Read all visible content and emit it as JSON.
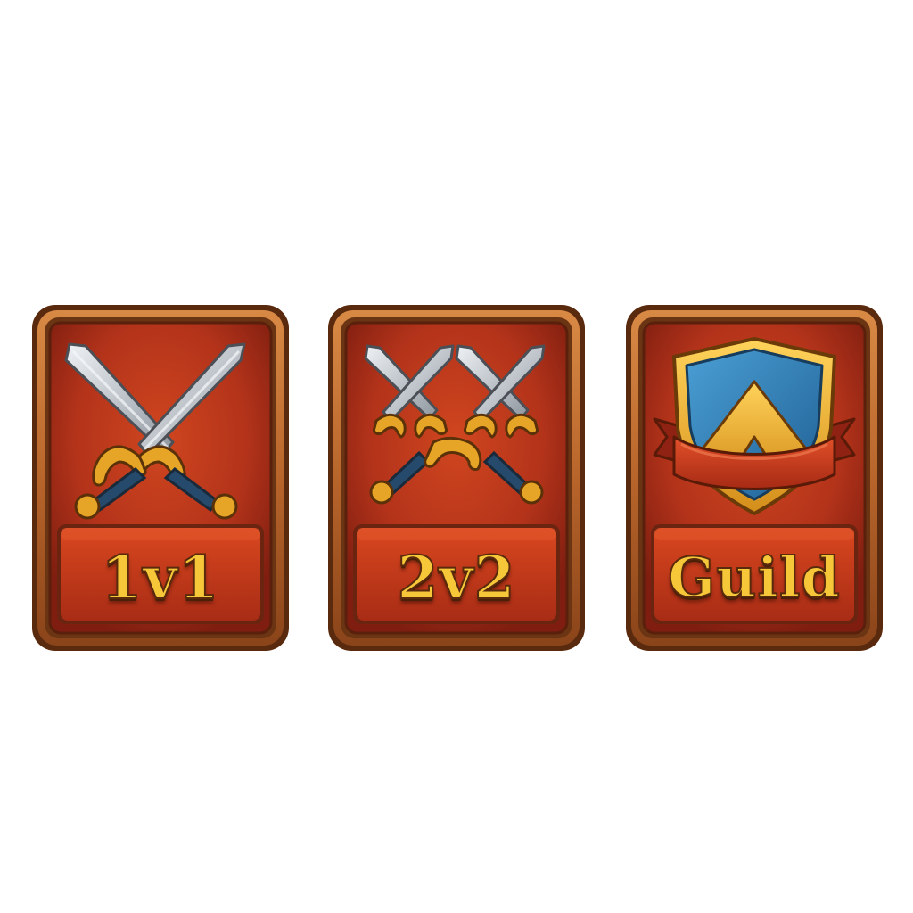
{
  "mode_select": {
    "cards": [
      {
        "label": "1v1",
        "icon": "crossed-swords-icon"
      },
      {
        "label": "2v2",
        "icon": "double-crossed-swords-icon"
      },
      {
        "label": "Guild",
        "icon": "guild-shield-icon"
      }
    ]
  },
  "colors": {
    "frame_outer": "#6b3513",
    "frame_bronze": "#b8652b",
    "panel_red": "#b3331a",
    "label_gold": "#f7c73a",
    "steel": "#c7ccd1",
    "gold_guard": "#e6a526",
    "shield_blue": "#2f7fb6"
  }
}
